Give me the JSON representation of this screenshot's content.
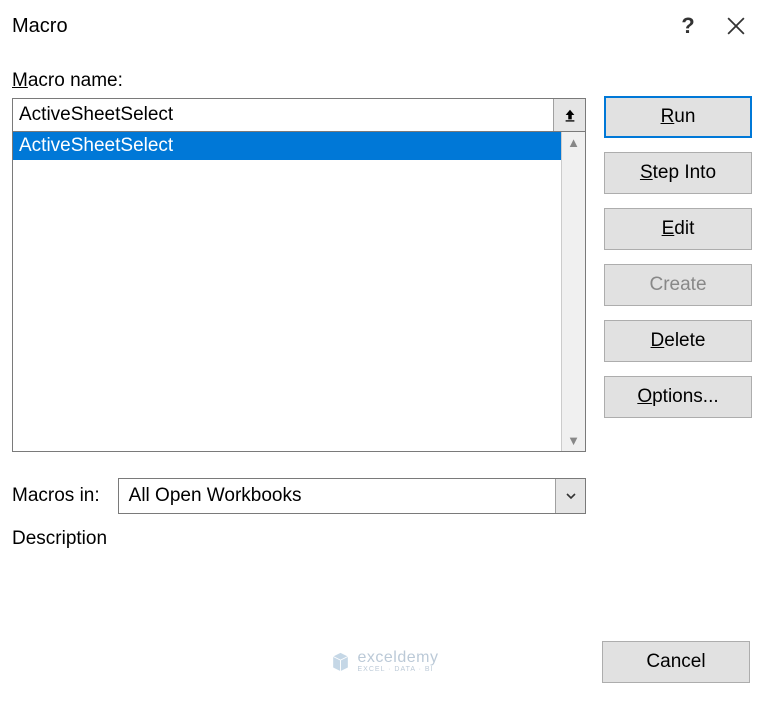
{
  "title": "Macro",
  "labels": {
    "macro_name_pre": "",
    "macro_name_ul": "M",
    "macro_name_post": "acro name:",
    "macros_in_pre": "M",
    "macros_in_ul": "a",
    "macros_in_post": "cros in:",
    "description": "Description"
  },
  "macro_name_value": "ActiveSheetSelect",
  "macro_list": [
    {
      "name": "ActiveSheetSelect",
      "selected": true
    }
  ],
  "macros_in_value": "All Open Workbooks",
  "buttons": {
    "run": {
      "pre": "",
      "ul": "R",
      "post": "un"
    },
    "step_into": {
      "pre": "",
      "ul": "S",
      "post": "tep Into"
    },
    "edit": {
      "pre": "",
      "ul": "E",
      "post": "dit"
    },
    "create": {
      "pre": "",
      "ul": "C",
      "post": "reate"
    },
    "delete": {
      "pre": "",
      "ul": "D",
      "post": "elete"
    },
    "options": {
      "pre": "",
      "ul": "O",
      "post": "ptions..."
    },
    "cancel": "Cancel"
  },
  "watermark": {
    "main": "exceldemy",
    "sub": "EXCEL · DATA · BI"
  }
}
